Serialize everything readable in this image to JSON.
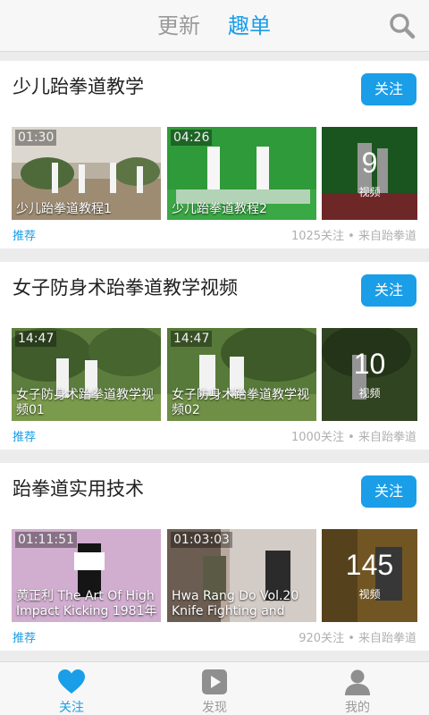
{
  "header": {
    "tabs": [
      {
        "label": "更新",
        "active": false
      },
      {
        "label": "趣单",
        "active": true
      }
    ],
    "search_icon": "search-icon"
  },
  "colors": {
    "accent": "#1a9ee8",
    "inactive": "#9a9a9a"
  },
  "channels": [
    {
      "title": "少儿跆拳道教学",
      "follow_label": "关注",
      "videos": [
        {
          "duration": "01:30",
          "title": "少儿跆拳道教程1"
        },
        {
          "duration": "04:26",
          "title": "少儿跆拳道教程2"
        }
      ],
      "count": "9",
      "count_label": "视频",
      "tag": "推荐",
      "meta": "1025关注 • 来自跆拳道"
    },
    {
      "title": "女子防身术跆拳道教学视频",
      "follow_label": "关注",
      "videos": [
        {
          "duration": "14:47",
          "title": "女子防身术跆拳道教学视频01"
        },
        {
          "duration": "14:47",
          "title": "女子防身术跆拳道教学视频02"
        }
      ],
      "count": "10",
      "count_label": "视频",
      "tag": "推荐",
      "meta": "1000关注 • 来自跆拳道"
    },
    {
      "title": "跆拳道实用技术",
      "follow_label": "关注",
      "videos": [
        {
          "duration": "01:11:51",
          "title": "黄正利 The Art Of High Impact Kicking 1981年"
        },
        {
          "duration": "01:03:03",
          "title": "Hwa Rang Do Vol.20 Knife Fighting and"
        }
      ],
      "count": "145",
      "count_label": "视频",
      "tag": "推荐",
      "meta": "920关注 • 来自跆拳道"
    }
  ],
  "nav": [
    {
      "label": "关注",
      "icon": "heart-icon",
      "active": true
    },
    {
      "label": "发现",
      "icon": "play-icon",
      "active": false
    },
    {
      "label": "我的",
      "icon": "user-icon",
      "active": false
    }
  ]
}
